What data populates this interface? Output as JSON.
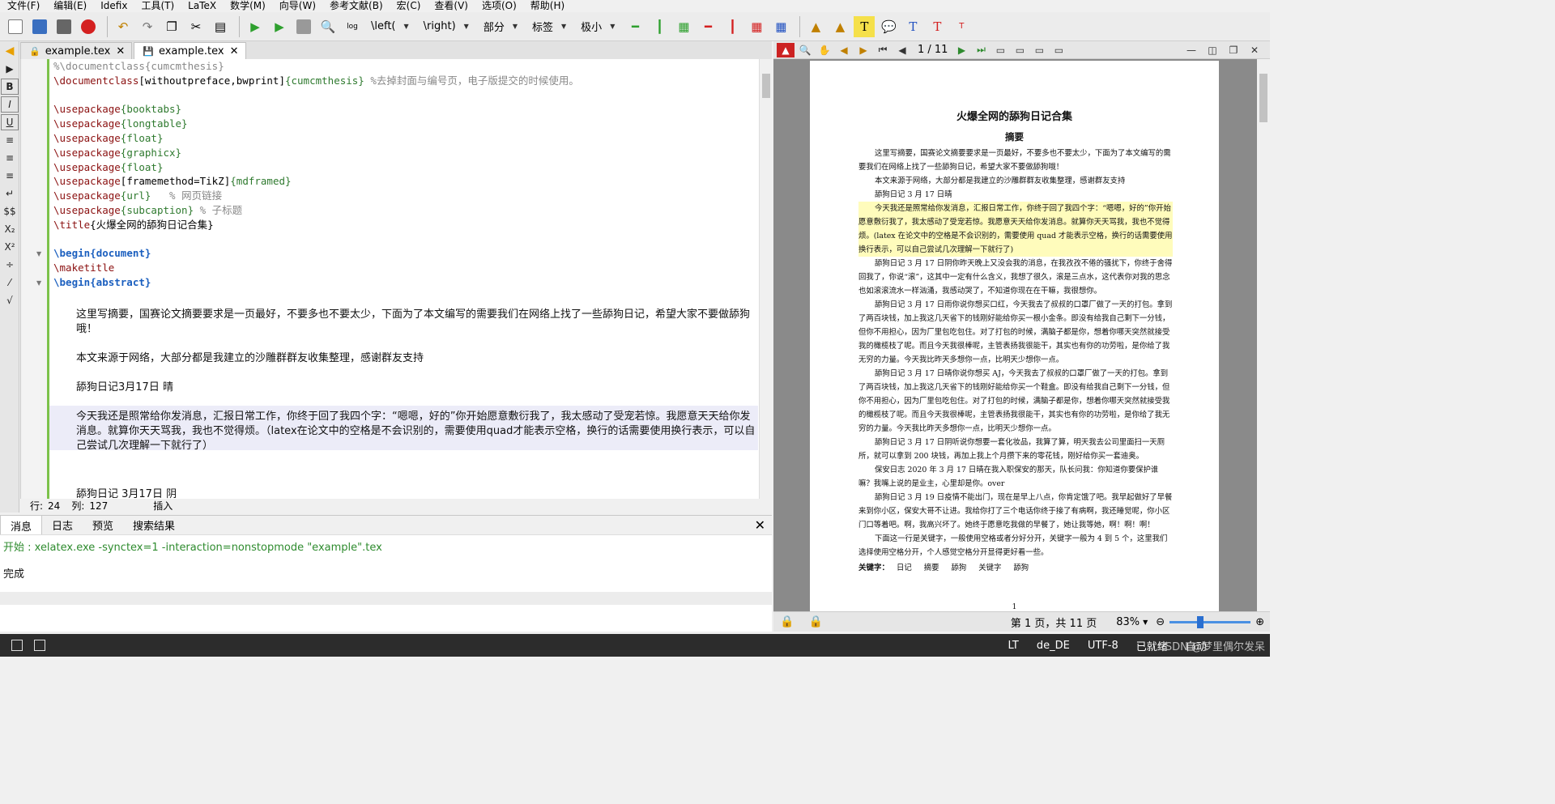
{
  "menu": [
    "文件(F)",
    "编辑(E)",
    "Idefix",
    "工具(T)",
    "LaTeX",
    "数学(M)",
    "向导(W)",
    "参考文献(B)",
    "宏(C)",
    "查看(V)",
    "选项(O)",
    "帮助(H)"
  ],
  "toolbar": {
    "combos": [
      "\\left(",
      "\\right)",
      "部分",
      "标签",
      "极小"
    ]
  },
  "tabs": [
    {
      "label": "example.tex",
      "icon": "lock-icon"
    },
    {
      "label": "example.tex",
      "icon": "save-icon"
    }
  ],
  "editor": {
    "lines": [
      "%\\documentclass{cumcmthesis}",
      "\\documentclass[withoutpreface,bwprint]{cumcmthesis} %去掉封面与编号页，电子版提交的时候使用。",
      "",
      "\\usepackage{booktabs}",
      "\\usepackage{longtable}",
      "\\usepackage{float}",
      "\\usepackage{graphicx}",
      "\\usepackage{float}",
      "\\usepackage[framemethod=TikZ]{mdframed}",
      "\\usepackage{url}   % 网页链接",
      "\\usepackage{subcaption} % 子标题",
      "\\title{火爆全网的舔狗日记合集}",
      "",
      "\\begin{document}",
      "\\maketitle",
      "\\begin{abstract}"
    ],
    "paragraphs": [
      "这里写摘要，国赛论文摘要要求是一页最好，不要多也不要太少，下面为了本文编写的需要我们在网络上找了一些舔狗日记，希望大家不要做舔狗哦！",
      "本文来源于网络，大部分都是我建立的沙雕群群友收集整理，感谢群友支持",
      "舔狗日记3月17日  晴",
      "今天我还是照常给你发消息，汇报日常工作，你终于回了我四个字：“嗯嗯，好的”你开始愿意敷衍我了，我太感动了受宠若惊。我愿意天天给你发消息。就算你天天骂我，我也不觉得烦。（latex在论文中的空格是不会识别的，需要使用quad才能表示空格，换行的话需要使用换行表示，可以自己尝试几次理解一下就行了）",
      "舔狗日记  3月17日  阴"
    ]
  },
  "status": {
    "row_label": "行:",
    "row": "24",
    "col_label": "列:",
    "col": "127",
    "mode": "插入"
  },
  "panel": {
    "tabs": [
      "消息",
      "日志",
      "预览",
      "搜索结果"
    ],
    "log_start": "开始 : xelatex.exe -synctex=1 -interaction=nonstopmode \"example\".tex",
    "log_done": "完成"
  },
  "pdf": {
    "page_nav": "1 / 11",
    "title": "火爆全网的舔狗日记合集",
    "subtitle": "摘要",
    "paragraphs": [
      "这里写摘要，国赛论文摘要要求是一页最好，不要多也不要太少，下面为了本文编写的需要我们在网络上找了一些舔狗日记，希望大家不要做舔狗哦！",
      "本文来源于网络，大部分都是我建立的沙雕群群友收集整理，感谢群友支持",
      "舔狗日记 3 月 17 日晴",
      "今天我还是照常给你发消息，汇报日常工作，你终于回了我四个字：“嗯嗯，好的”你开始愿意敷衍我了，我太感动了受宠若惊。我愿意天天给你发消息。就算你天天骂我，我也不觉得烦。(latex 在论文中的空格是不会识别的，需要使用 quad 才能表示空格，换行的话需要使用换行表示，可以自己尝试几次理解一下就行了)",
      "舔狗日记 3 月 17 日阴你昨天晚上又没会我的消息，在我孜孜不倦的骚扰下，你终于舍得回我了，你说“滚”，这其中一定有什么含义，我想了很久，滚是三点水，这代表你对我的思念也如滚滚流水一样汹涌，我感动哭了，不知道你现在在干嘛，我很想你。",
      "舔狗日记 3 月 17 日雨你说你想买口红，今天我去了叔叔的口罩厂做了一天的打包。拿到了两百块钱，加上我这几天省下的钱刚好能给你买一根小金条。即没有给我自己剩下一分钱，但你不用担心，因为厂里包吃包住。对了打包的时候，满脑子都是你，想着你哪天突然就接受我的橄榄枝了呢。而且今天我很棒呢，主管表扬我很能干，其实也有你的功劳啦，是你给了我无穷的力量。今天我比昨天多想你一点，比明天少想你一点。",
      "舔狗日记 3 月 17 日晴你说你想买 AJ，今天我去了叔叔的口罩厂做了一天的打包。拿到了两百块钱，加上我这几天省下的钱刚好能给你买一个鞋盒。即没有给我自己剩下一分钱，但你不用担心，因为厂里包吃包住。对了打包的时候，满脑子都是你，想着你哪天突然就接受我的橄榄枝了呢。而且今天我很棒呢，主管表扬我很能干，其实也有你的功劳啦，是你给了我无穷的力量。今天我比昨天多想你一点，比明天少想你一点。",
      "舔狗日记 3 月 17 日阴听说你想要一套化妆品，我算了算，明天我去公司里面扫一天厕所，就可以拿到 200 块钱，再加上我上个月攒下来的零花钱，刚好给你买一套迪奥。",
      "保安日志 2020 年 3 月 17 日晴在我入职保安的那天，队长问我：你知道你要保护谁嘛？我嘴上说的是业主，心里却是你。over",
      "舔狗日记 3 月 19 日疫情不能出门，现在是早上八点，你肯定饿了吧。我早起做好了早餐来到你小区，保安大哥不让进。我给你打了三个电话你终于接了有病啊，我还睡觉呢，你小区门口等着吧。啊，我高兴坏了。她终于愿意吃我做的早餐了，她让我等她，啊！啊！啊！",
      "下面这一行是关键字，一般使用空格或者分好分开，关键字一般为 4 到 5 个，这里我们选择使用空格分开，个人感觉空格分开显得更好看一些。"
    ],
    "keywords_label": "关键字：",
    "keywords": [
      "日记",
      "摘要",
      "舔狗",
      "关键字",
      "舔狗"
    ],
    "page_number": "1",
    "status_page": "第 1 页，共 11 页",
    "zoom": "83%",
    "zoom_level": 0.37
  },
  "statusbar": {
    "lt": "LT",
    "lang": "de_DE",
    "encoding": "UTF-8",
    "ready": "已就绪",
    "auto": "自动",
    "watermark": "CSDN @梦里偶尔发呆"
  }
}
